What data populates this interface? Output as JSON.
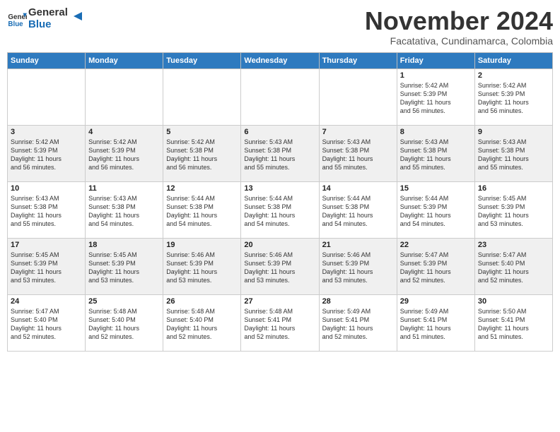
{
  "header": {
    "logo_line1": "General",
    "logo_line2": "Blue",
    "month": "November 2024",
    "location": "Facatativa, Cundinamarca, Colombia"
  },
  "days_of_week": [
    "Sunday",
    "Monday",
    "Tuesday",
    "Wednesday",
    "Thursday",
    "Friday",
    "Saturday"
  ],
  "weeks": [
    [
      {
        "day": "",
        "content": ""
      },
      {
        "day": "",
        "content": ""
      },
      {
        "day": "",
        "content": ""
      },
      {
        "day": "",
        "content": ""
      },
      {
        "day": "",
        "content": ""
      },
      {
        "day": "1",
        "content": "Sunrise: 5:42 AM\nSunset: 5:39 PM\nDaylight: 11 hours\nand 56 minutes."
      },
      {
        "day": "2",
        "content": "Sunrise: 5:42 AM\nSunset: 5:39 PM\nDaylight: 11 hours\nand 56 minutes."
      }
    ],
    [
      {
        "day": "3",
        "content": "Sunrise: 5:42 AM\nSunset: 5:39 PM\nDaylight: 11 hours\nand 56 minutes."
      },
      {
        "day": "4",
        "content": "Sunrise: 5:42 AM\nSunset: 5:39 PM\nDaylight: 11 hours\nand 56 minutes."
      },
      {
        "day": "5",
        "content": "Sunrise: 5:42 AM\nSunset: 5:38 PM\nDaylight: 11 hours\nand 56 minutes."
      },
      {
        "day": "6",
        "content": "Sunrise: 5:43 AM\nSunset: 5:38 PM\nDaylight: 11 hours\nand 55 minutes."
      },
      {
        "day": "7",
        "content": "Sunrise: 5:43 AM\nSunset: 5:38 PM\nDaylight: 11 hours\nand 55 minutes."
      },
      {
        "day": "8",
        "content": "Sunrise: 5:43 AM\nSunset: 5:38 PM\nDaylight: 11 hours\nand 55 minutes."
      },
      {
        "day": "9",
        "content": "Sunrise: 5:43 AM\nSunset: 5:38 PM\nDaylight: 11 hours\nand 55 minutes."
      }
    ],
    [
      {
        "day": "10",
        "content": "Sunrise: 5:43 AM\nSunset: 5:38 PM\nDaylight: 11 hours\nand 55 minutes."
      },
      {
        "day": "11",
        "content": "Sunrise: 5:43 AM\nSunset: 5:38 PM\nDaylight: 11 hours\nand 54 minutes."
      },
      {
        "day": "12",
        "content": "Sunrise: 5:44 AM\nSunset: 5:38 PM\nDaylight: 11 hours\nand 54 minutes."
      },
      {
        "day": "13",
        "content": "Sunrise: 5:44 AM\nSunset: 5:38 PM\nDaylight: 11 hours\nand 54 minutes."
      },
      {
        "day": "14",
        "content": "Sunrise: 5:44 AM\nSunset: 5:38 PM\nDaylight: 11 hours\nand 54 minutes."
      },
      {
        "day": "15",
        "content": "Sunrise: 5:44 AM\nSunset: 5:39 PM\nDaylight: 11 hours\nand 54 minutes."
      },
      {
        "day": "16",
        "content": "Sunrise: 5:45 AM\nSunset: 5:39 PM\nDaylight: 11 hours\nand 53 minutes."
      }
    ],
    [
      {
        "day": "17",
        "content": "Sunrise: 5:45 AM\nSunset: 5:39 PM\nDaylight: 11 hours\nand 53 minutes."
      },
      {
        "day": "18",
        "content": "Sunrise: 5:45 AM\nSunset: 5:39 PM\nDaylight: 11 hours\nand 53 minutes."
      },
      {
        "day": "19",
        "content": "Sunrise: 5:46 AM\nSunset: 5:39 PM\nDaylight: 11 hours\nand 53 minutes."
      },
      {
        "day": "20",
        "content": "Sunrise: 5:46 AM\nSunset: 5:39 PM\nDaylight: 11 hours\nand 53 minutes."
      },
      {
        "day": "21",
        "content": "Sunrise: 5:46 AM\nSunset: 5:39 PM\nDaylight: 11 hours\nand 53 minutes."
      },
      {
        "day": "22",
        "content": "Sunrise: 5:47 AM\nSunset: 5:39 PM\nDaylight: 11 hours\nand 52 minutes."
      },
      {
        "day": "23",
        "content": "Sunrise: 5:47 AM\nSunset: 5:40 PM\nDaylight: 11 hours\nand 52 minutes."
      }
    ],
    [
      {
        "day": "24",
        "content": "Sunrise: 5:47 AM\nSunset: 5:40 PM\nDaylight: 11 hours\nand 52 minutes."
      },
      {
        "day": "25",
        "content": "Sunrise: 5:48 AM\nSunset: 5:40 PM\nDaylight: 11 hours\nand 52 minutes."
      },
      {
        "day": "26",
        "content": "Sunrise: 5:48 AM\nSunset: 5:40 PM\nDaylight: 11 hours\nand 52 minutes."
      },
      {
        "day": "27",
        "content": "Sunrise: 5:48 AM\nSunset: 5:41 PM\nDaylight: 11 hours\nand 52 minutes."
      },
      {
        "day": "28",
        "content": "Sunrise: 5:49 AM\nSunset: 5:41 PM\nDaylight: 11 hours\nand 52 minutes."
      },
      {
        "day": "29",
        "content": "Sunrise: 5:49 AM\nSunset: 5:41 PM\nDaylight: 11 hours\nand 51 minutes."
      },
      {
        "day": "30",
        "content": "Sunrise: 5:50 AM\nSunset: 5:41 PM\nDaylight: 11 hours\nand 51 minutes."
      }
    ]
  ]
}
